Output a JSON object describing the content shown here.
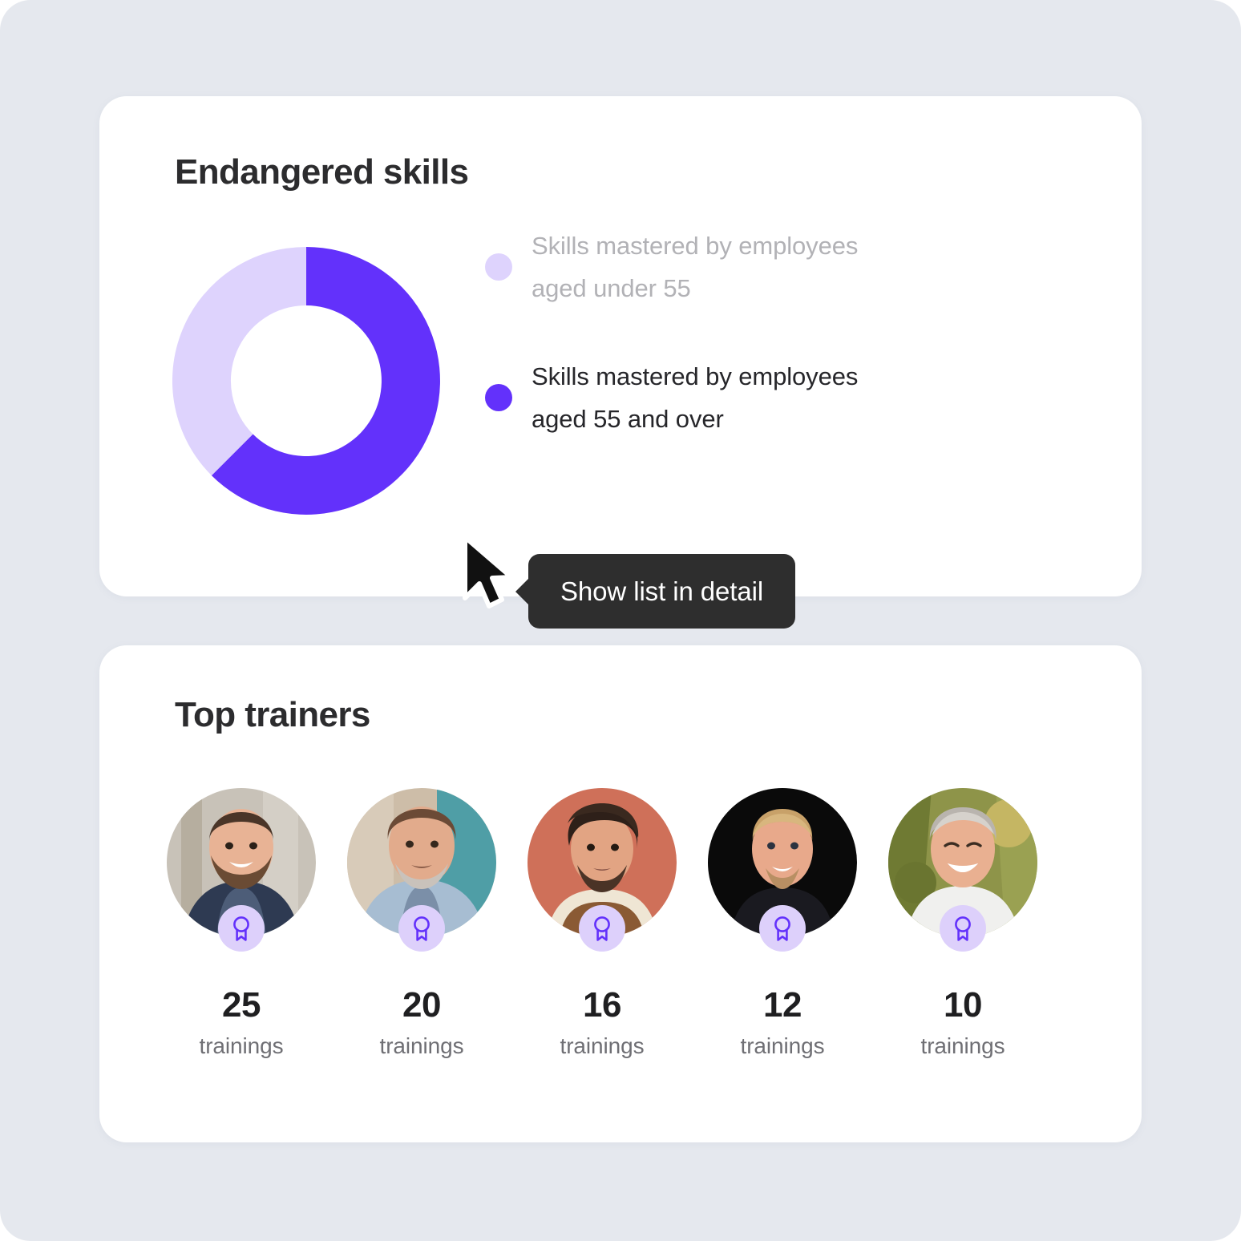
{
  "theme": {
    "page_background": "#e5e8ee",
    "card_background": "#ffffff",
    "accent_purple": "#6331fb",
    "accent_purple_light": "#ded3fd",
    "badge_background": "#ddd0fb",
    "tooltip_background": "#2e2e2e",
    "title_color": "#2c2c2e",
    "muted_text": "#b2b2b6"
  },
  "skills_card": {
    "title": "Endangered skills",
    "legend": [
      {
        "id": "under-55",
        "label": "Skills mastered by employees aged under 55",
        "line1": "Skills mastered by employees",
        "line2": "aged under 55",
        "color": "#ded3fd",
        "state": "muted"
      },
      {
        "id": "55-and-over",
        "label": "Skills mastered by employees aged 55 and over",
        "line1": "Skills mastered by employees",
        "line2": "aged 55 and over",
        "color": "#6331fb",
        "state": "active"
      }
    ],
    "tooltip": {
      "text": "Show list in detail",
      "background": "#2e2e2e",
      "text_color": "#ffffff"
    },
    "cursor_icon": "arrow-pointer-icon"
  },
  "chart_data": {
    "type": "pie",
    "variant": "donut",
    "title": "Endangered skills",
    "labels": [
      "Skills mastered by employees aged 55 and over",
      "Skills mastered by employees aged under 55"
    ],
    "values": [
      62.5,
      37.5
    ],
    "unit": "percent",
    "colors": [
      "#6331fb",
      "#ded3fd"
    ],
    "start_angle_deg": 0,
    "direction": "clockwise",
    "inner_radius_ratio": 0.5,
    "legend_position": "right",
    "grid": false
  },
  "trainers_card": {
    "title": "Top trainers",
    "unit_label": "trainings",
    "badge_icon": "award-ribbon-icon",
    "trainers": [
      {
        "rank": 1,
        "count": "25",
        "unit": "trainings",
        "photo_alt": "smiling bearded man in navy shirt",
        "bg": "#c8c2b8",
        "skin": "#e8b395",
        "hair": "#4a3528",
        "shirt": "#2e3a52"
      },
      {
        "rank": 2,
        "count": "20",
        "unit": "trainings",
        "photo_alt": "man in denim jacket with grey stubble",
        "bg": "#5fa3a7",
        "skin": "#e2ab8c",
        "hair": "#6b4a36",
        "shirt": "#a7bdd2"
      },
      {
        "rank": 3,
        "count": "16",
        "unit": "trainings",
        "photo_alt": "curly haired man against terracotta wall",
        "bg": "#cf7059",
        "skin": "#e2a483",
        "hair": "#2e2019",
        "shirt": "#8a5a34"
      },
      {
        "rank": 4,
        "count": "12",
        "unit": "trainings",
        "photo_alt": "blond man on black background",
        "bg": "#0a0a0a",
        "skin": "#e8a98b",
        "hair": "#c8a169",
        "shirt": "#1a1a20"
      },
      {
        "rank": 5,
        "count": "10",
        "unit": "trainings",
        "photo_alt": "grey haired man laughing outdoors",
        "bg": "#7e8a3c",
        "skin": "#e9b091",
        "hair": "#b9b4ae",
        "shirt": "#f0f0ee"
      }
    ]
  }
}
